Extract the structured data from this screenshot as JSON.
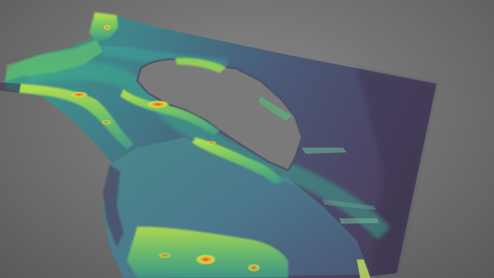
{
  "viewer": {
    "background_color": "#707070",
    "colormap": [
      "#3f3a5e",
      "#3f5f7f",
      "#2d8a8a",
      "#3fb07a",
      "#a8d84a",
      "#f0e03a",
      "#f08a30",
      "#e04a30"
    ]
  },
  "model": {
    "subject": "bathymetry-terrain-model",
    "features": [
      "harbor-basin",
      "island-void",
      "breakwater-ridges",
      "sloped-seabed"
    ]
  }
}
